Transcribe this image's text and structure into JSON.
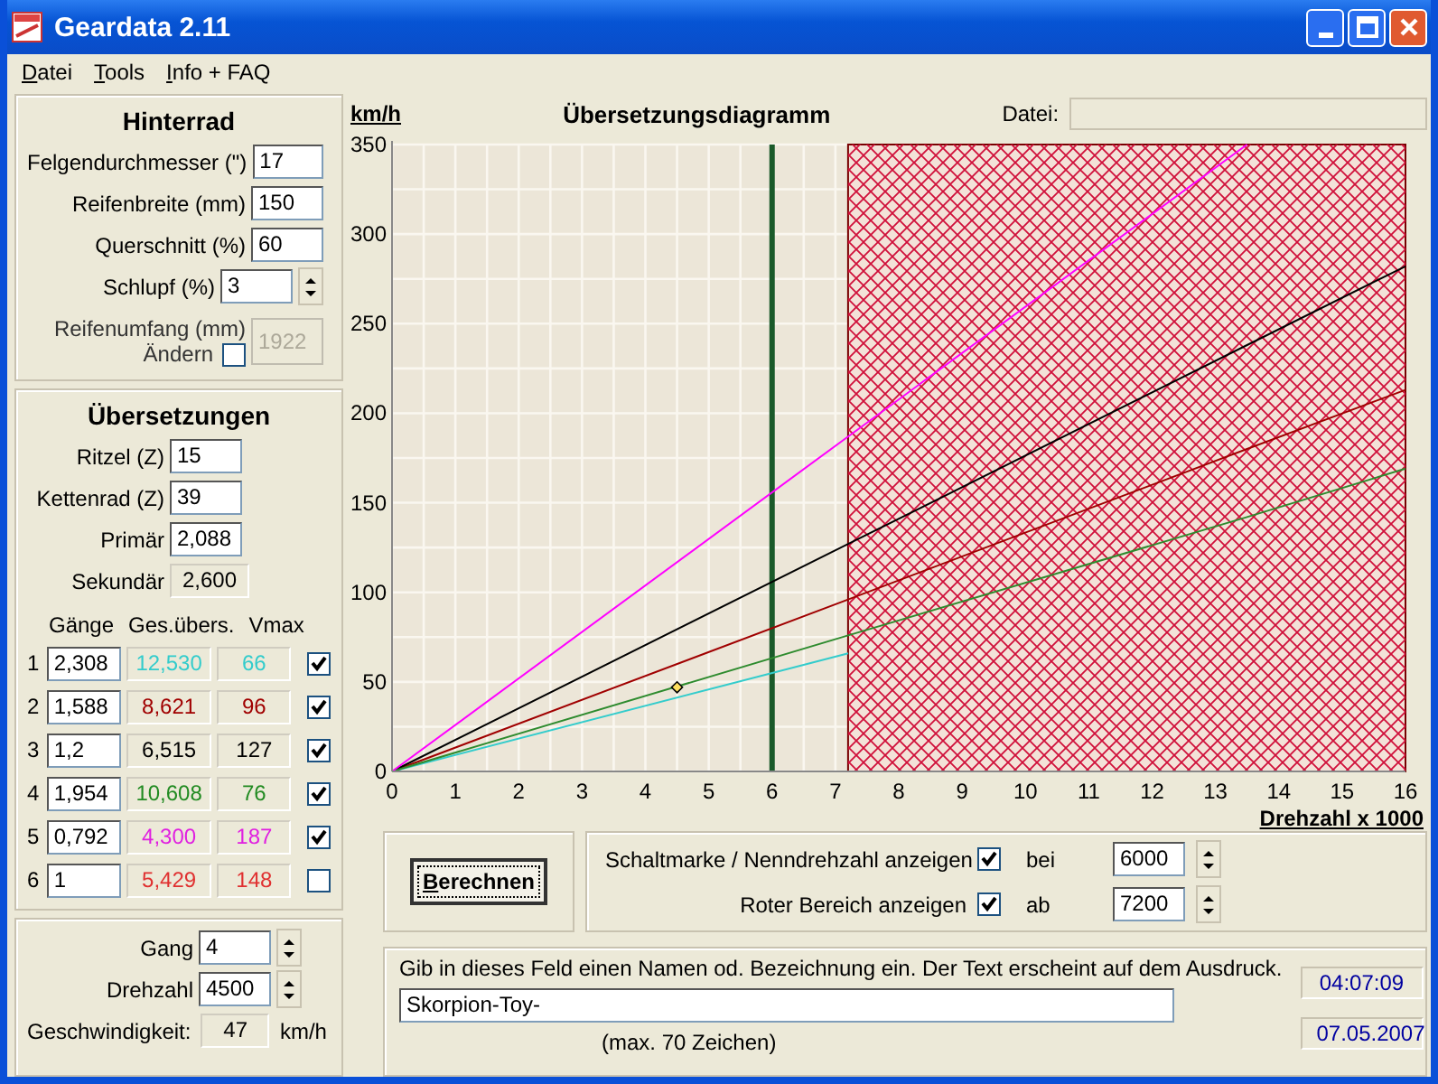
{
  "window": {
    "title": "Geardata 2.11"
  },
  "menu": [
    {
      "label": "Datei"
    },
    {
      "label": "Tools"
    },
    {
      "label": "Info + FAQ"
    }
  ],
  "hinterrad": {
    "title": "Hinterrad",
    "fields": [
      {
        "label": "Felgendurchmesser (\")",
        "value": "17",
        "kind": "input"
      },
      {
        "label": "Reifenbreite (mm)",
        "value": "150",
        "kind": "input"
      },
      {
        "label": "Querschnitt (%)",
        "value": "60",
        "kind": "input"
      },
      {
        "label": "Schlupf (%)",
        "value": "3",
        "kind": "spinner"
      }
    ],
    "reifenumfang": {
      "label": "Reifenumfang (mm)",
      "value": "1922",
      "disabled": true
    },
    "aendern": {
      "label": "Ändern",
      "checked": false
    }
  },
  "uebersetzungen": {
    "title": "Übersetzungen",
    "fields": [
      {
        "label": "Ritzel (Z)",
        "value": "15",
        "kind": "input"
      },
      {
        "label": "Kettenrad (Z)",
        "value": "39",
        "kind": "input"
      },
      {
        "label": "Primär",
        "value": "2,088",
        "kind": "input"
      },
      {
        "label": "Sekundär",
        "value": "2,600",
        "kind": "readonly"
      }
    ],
    "columns": [
      "Gänge",
      "Ges.übers.",
      "Vmax"
    ],
    "rows": [
      {
        "number": "1",
        "ratio": "2,308",
        "total": "12,530",
        "vmax": "66",
        "color": "#33cccc",
        "checked": true
      },
      {
        "number": "2",
        "ratio": "1,588",
        "total": "8,621",
        "vmax": "96",
        "color": "#a00000",
        "checked": true
      },
      {
        "number": "3",
        "ratio": "1,2",
        "total": "6,515",
        "vmax": "127",
        "color": "#000000",
        "checked": true
      },
      {
        "number": "4",
        "ratio": "1,954",
        "total": "10,608",
        "vmax": "76",
        "color": "#228b22",
        "checked": true
      },
      {
        "number": "5",
        "ratio": "0,792",
        "total": "4,300",
        "vmax": "187",
        "color": "#e020e0",
        "checked": true
      },
      {
        "number": "6",
        "ratio": "1",
        "total": "5,429",
        "vmax": "148",
        "color": "#e03030",
        "checked": false
      }
    ]
  },
  "aktuell": {
    "gang": {
      "label": "Gang",
      "value": "4"
    },
    "drehzahl": {
      "label": "Drehzahl",
      "value": "4500"
    },
    "geschwindigkeit": {
      "label": "Geschwindigkeit:",
      "value": "47",
      "unit": "km/h"
    }
  },
  "diagram": {
    "datei_label": "Datei:",
    "chart_data": {
      "type": "line",
      "title": "Übersetzungsdiagramm",
      "xlabel": "Drehzahl x 1000",
      "ylabel": "km/h",
      "x": [
        0,
        7.2,
        13.5,
        16
      ],
      "series": [
        {
          "color": "#33cccc",
          "values": [
            0,
            66,
            null,
            null
          ]
        },
        {
          "color": "#a00000",
          "values": [
            0,
            96,
            180,
            213
          ]
        },
        {
          "color": "#000000",
          "values": [
            0,
            127,
            238,
            282
          ]
        },
        {
          "color": "#2e8b2e",
          "values": [
            0,
            76,
            142,
            169
          ]
        },
        {
          "color": "#ff00ff",
          "values": [
            0,
            187,
            350,
            null
          ]
        }
      ],
      "grid": true,
      "xlim": [
        0,
        16
      ],
      "ylim": [
        0,
        350
      ],
      "xticks": [
        0,
        1,
        2,
        3,
        4,
        5,
        6,
        7,
        8,
        9,
        10,
        11,
        12,
        13,
        14,
        15,
        16
      ],
      "yticks": [
        0,
        50,
        100,
        150,
        200,
        250,
        300,
        350
      ],
      "ref_lines": [
        {
          "axis": "x",
          "value": 6
        }
      ],
      "bands": [
        {
          "axis": "x",
          "from": 7.2,
          "to": 16
        }
      ]
    }
  },
  "berechnen": {
    "label": "Berechnen"
  },
  "options": [
    {
      "label": "Schaltmarke / Nenndrehzahl anzeigen",
      "checked": true,
      "prefix": "bei",
      "value": "6000"
    },
    {
      "label": "Roter Bereich anzeigen",
      "checked": true,
      "prefix": "ab",
      "value": "7200"
    }
  ],
  "beschriftung": {
    "instruction": "Gib in dieses Feld einen Namen od. Bezeichnung ein. Der Text erscheint auf dem Ausdruck.",
    "value": "Skorpion-Toy-",
    "hint": "(max. 70 Zeichen)",
    "time": "04:07:09",
    "date": "07.05.2007"
  }
}
